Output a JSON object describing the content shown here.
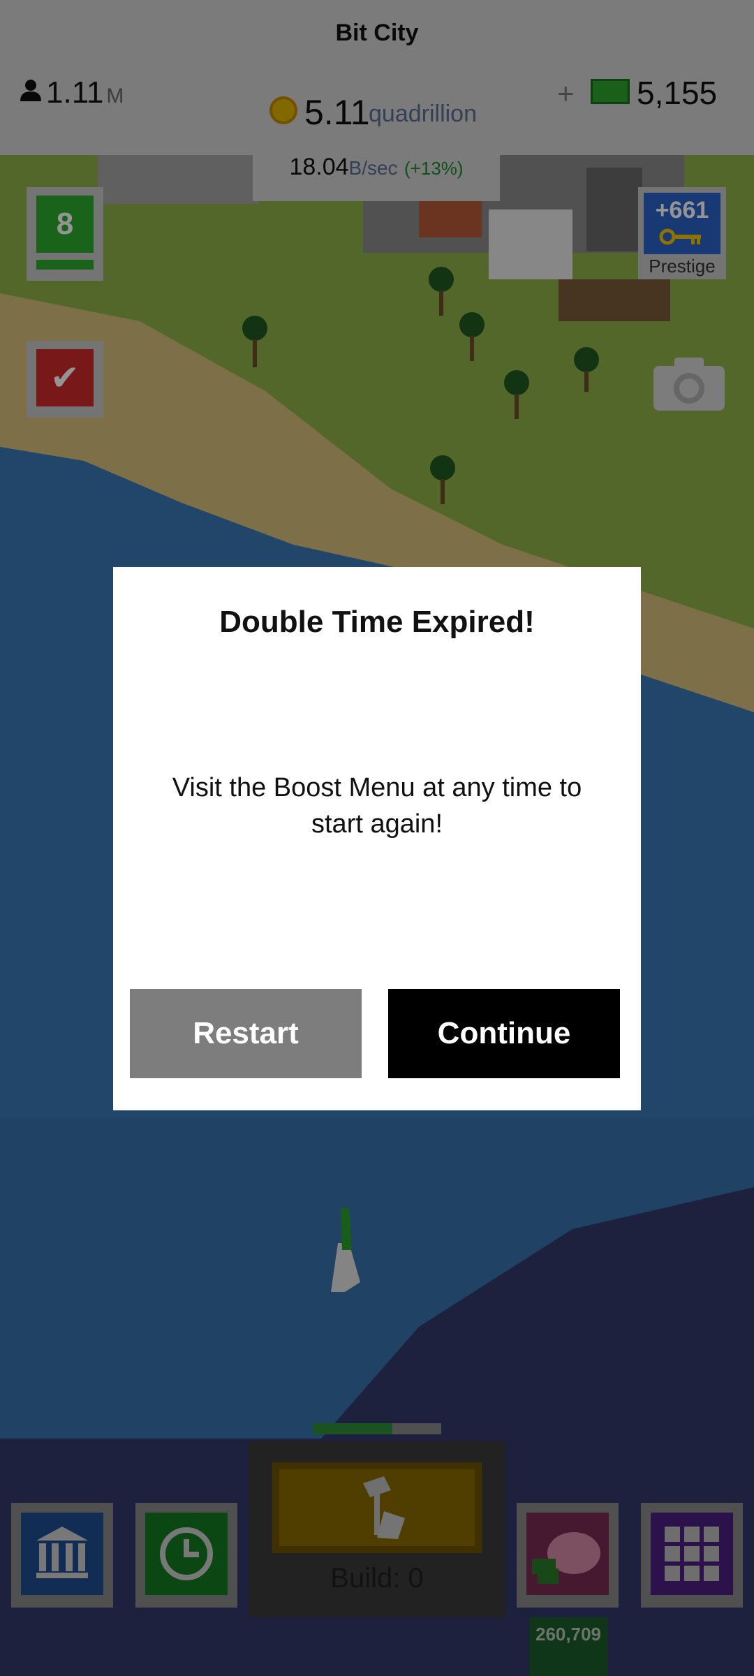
{
  "header": {
    "city_name": "Bit City",
    "population": "1.11",
    "population_unit": "M",
    "cash_plus": "+",
    "cash_value": "5,155",
    "coins_value": "5.11",
    "coins_unit": "quadrillion",
    "rate_value": "18.04",
    "rate_unit": "B/sec",
    "rate_bonus": "(+13%)"
  },
  "side_buttons": {
    "level_number": "8",
    "task_check": "✔",
    "prestige_value": "+661",
    "prestige_label": "Prestige"
  },
  "dialog": {
    "title": "Double Time Expired!",
    "message": "Visit the Boost Menu at any time to start again!",
    "restart_label": "Restart",
    "continue_label": "Continue"
  },
  "bottom": {
    "build_label": "Build: 0",
    "build_progress": 0.62,
    "piggy_bank_value": "260,709"
  },
  "colors": {
    "accent_green": "#2eab2e",
    "dialog_bg": "#ffffff",
    "continue_bg": "#000000",
    "restart_bg": "#7d7d7d"
  },
  "icons": [
    "person-icon",
    "coin-icon",
    "cash-icon",
    "check-icon",
    "key-icon",
    "camera-icon",
    "hammer-icon",
    "bank-icon",
    "clock-icon",
    "piggy-bank-icon",
    "grid-menu-icon"
  ]
}
